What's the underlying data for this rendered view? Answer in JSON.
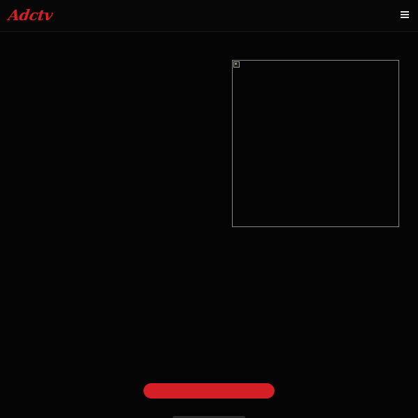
{
  "header": {
    "logo_text": "Adctv",
    "menu_icon": "hamburger-menu-icon",
    "colors": {
      "logo": "#d32027",
      "menu_icon": "#e6e6e6"
    }
  },
  "main": {
    "media": {
      "state": "broken-image",
      "icon": "broken-image-icon"
    }
  },
  "cta": {
    "label": "",
    "color": "#d41f26"
  },
  "theme": {
    "background": "#050505"
  }
}
